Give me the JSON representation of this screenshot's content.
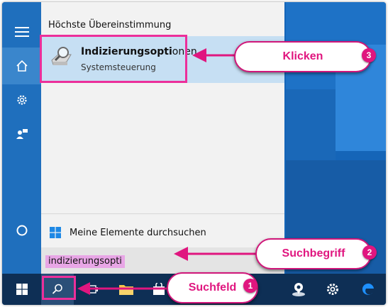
{
  "start_panel": {
    "header": "Höchste Übereinstimmung",
    "best_match": {
      "title_bold": "Indizierungsopti",
      "title_rest": "onen",
      "subtitle": "Systemsteuerung"
    },
    "my_stuff_label": "Meine Elemente durchsuchen",
    "search_query": "indizierungsopti"
  },
  "annotations": {
    "click": {
      "label": "Klicken",
      "step": "3"
    },
    "search_term": {
      "label": "Suchbegriff",
      "step": "2"
    },
    "search_field": {
      "label": "Suchfeld",
      "step": "1"
    }
  },
  "colors": {
    "highlight": "#ec2f9a",
    "callout_text": "#e0167f",
    "result_selected": "#c6dff3",
    "taskbar": "#0e2f55"
  }
}
